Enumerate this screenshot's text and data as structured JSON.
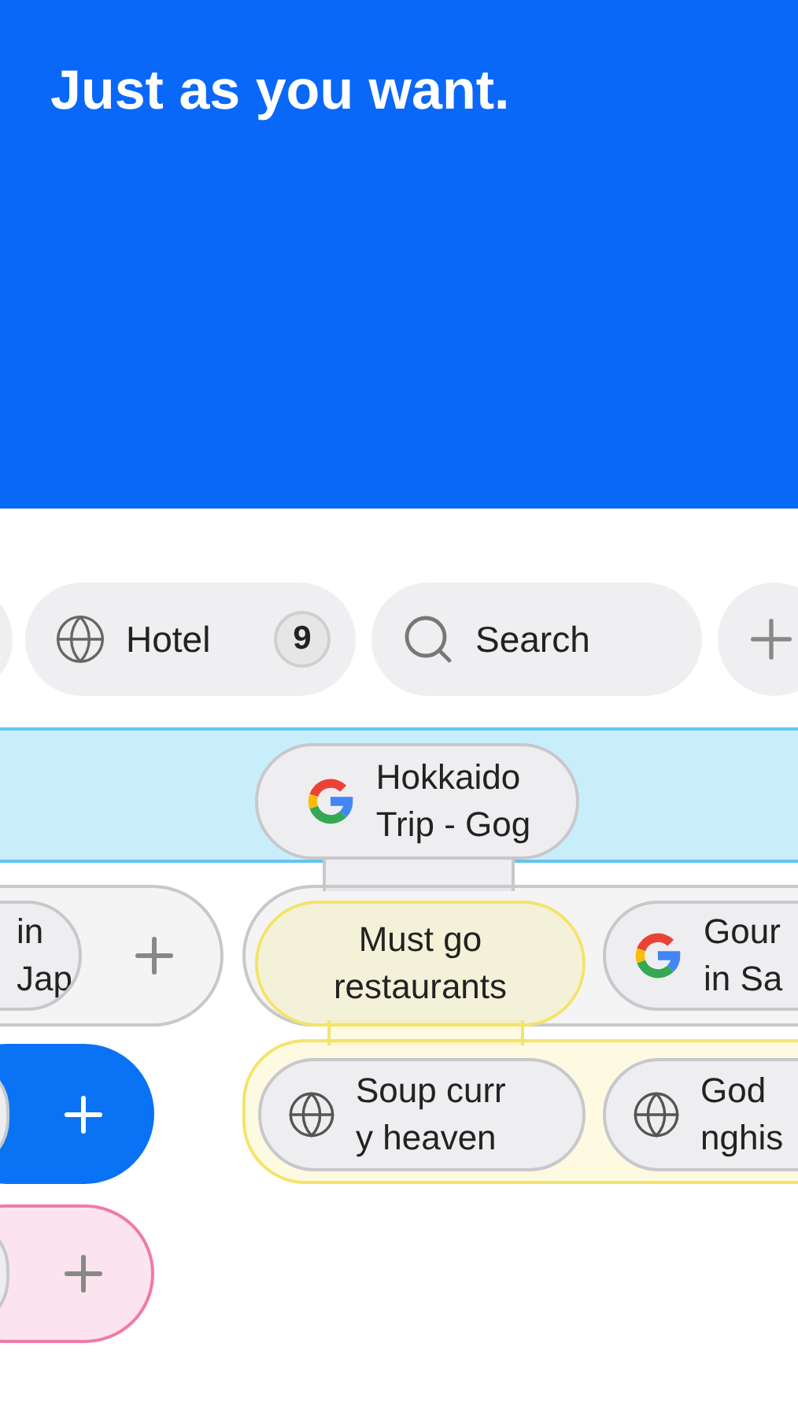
{
  "headline": "Just as you want.",
  "toolbar": [
    {
      "kind": "tab",
      "label": "Hotel",
      "count": "9"
    },
    {
      "kind": "search",
      "label": "Search"
    },
    {
      "kind": "add"
    }
  ],
  "root_tab": {
    "kind": "google",
    "lines": [
      "Hokkaido",
      "Trip - Gog"
    ]
  },
  "groups": [
    {
      "color": "#c8c8cc",
      "filled": false,
      "tabs": [
        {
          "kind": "plain",
          "lines": [
            "in",
            "Jap"
          ]
        }
      ]
    },
    {
      "color": "#c8c8cc",
      "filled": false,
      "tabs": [
        {
          "kind": "folder",
          "lines": [
            "Must go",
            "restaurants"
          ],
          "color": "#f3e46a",
          "tabs": [
            {
              "kind": "web",
              "lines": [
                "Soup curr",
                "y heaven"
              ]
            },
            {
              "kind": "web",
              "lines": [
                "God",
                "nghis"
              ]
            }
          ]
        },
        {
          "kind": "google",
          "lines": [
            "Gour",
            "in Sa"
          ]
        }
      ]
    },
    {
      "color": "#0a72f5",
      "filled": true
    },
    {
      "color": "#f07aa8",
      "filled": false
    }
  ]
}
